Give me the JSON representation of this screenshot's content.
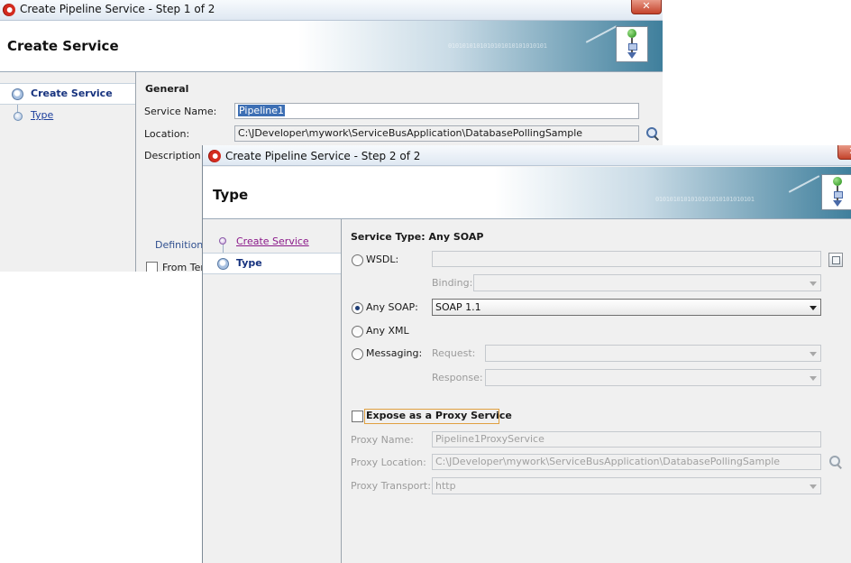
{
  "step1": {
    "title": "Create Pipeline Service - Step 1 of 2",
    "close_glyph": "✕",
    "header": "Create Service",
    "banner_binary": "0101010101010101010101010101",
    "nav": [
      {
        "label": "Create Service",
        "state": "current"
      },
      {
        "label": "Type",
        "state": "link"
      }
    ],
    "section_title": "General",
    "service_name_label": "Service Name:",
    "service_name_value": "Pipeline1",
    "location_label": "Location:",
    "location_value": "C:\\JDeveloper\\mywork\\ServiceBusApplication\\DatabasePollingSample",
    "description_label": "Description",
    "definition_label": "Definition",
    "from_template_label": "From Ter"
  },
  "step2": {
    "title": "Create Pipeline Service - Step 2 of 2",
    "header": "Type",
    "banner_binary": "0101010101010101010101010101",
    "nav": [
      {
        "label": "Create Service",
        "state": "visited"
      },
      {
        "label": "Type",
        "state": "current"
      }
    ],
    "service_type_label": "Service Type: Any SOAP",
    "wsdl": {
      "label": "WSDL:",
      "value": ""
    },
    "binding": {
      "label": "Binding:",
      "value": ""
    },
    "any_soap": {
      "label": "Any SOAP:",
      "value": "SOAP 1.1",
      "selected": true
    },
    "any_xml": {
      "label": "Any XML"
    },
    "messaging": {
      "label": "Messaging:"
    },
    "request": {
      "label": "Request:",
      "value": ""
    },
    "response": {
      "label": "Response:",
      "value": ""
    },
    "expose_proxy": {
      "label": "Expose as a Proxy Service",
      "checked": false
    },
    "proxy_name": {
      "label": "Proxy Name:",
      "value": "Pipeline1ProxyService"
    },
    "proxy_location": {
      "label": "Proxy Location:",
      "value": "C:\\JDeveloper\\mywork\\ServiceBusApplication\\DatabasePollingSample"
    },
    "proxy_transport": {
      "label": "Proxy Transport:",
      "value": "http"
    }
  },
  "icons": {
    "app": "oracle-jdeveloper-icon",
    "wizard": "workflow-wizard-icon",
    "browse": "magnifier-icon",
    "wsdl_browse": "document-browse-icon"
  },
  "colors": {
    "link": "#1d3f9c",
    "visited_link": "#8b1a8a",
    "current_step": "#16327e",
    "selection": "#3d6fb4",
    "focus": "#e0a040"
  }
}
